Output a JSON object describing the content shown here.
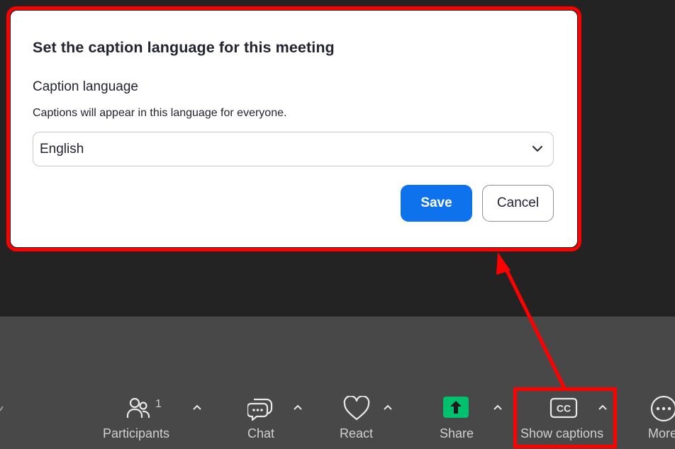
{
  "dialog": {
    "title": "Set the caption language for this meeting",
    "field_label": "Caption language",
    "help_text": "Captions will appear in this language for everyone.",
    "language_value": "English",
    "save_label": "Save",
    "cancel_label": "Cancel"
  },
  "toolbar": {
    "participants": {
      "label": "Participants",
      "count": "1"
    },
    "chat": {
      "label": "Chat"
    },
    "react": {
      "label": "React"
    },
    "share": {
      "label": "Share"
    },
    "captions": {
      "label": "Show captions",
      "icon_text": "CC"
    },
    "more": {
      "label": "More"
    }
  },
  "colors": {
    "primary_button": "#0e72ed",
    "share_icon": "#00c26e",
    "annotation_red": "#ff0000",
    "toolbar_bg": "#484848",
    "meeting_bg": "#232323"
  }
}
